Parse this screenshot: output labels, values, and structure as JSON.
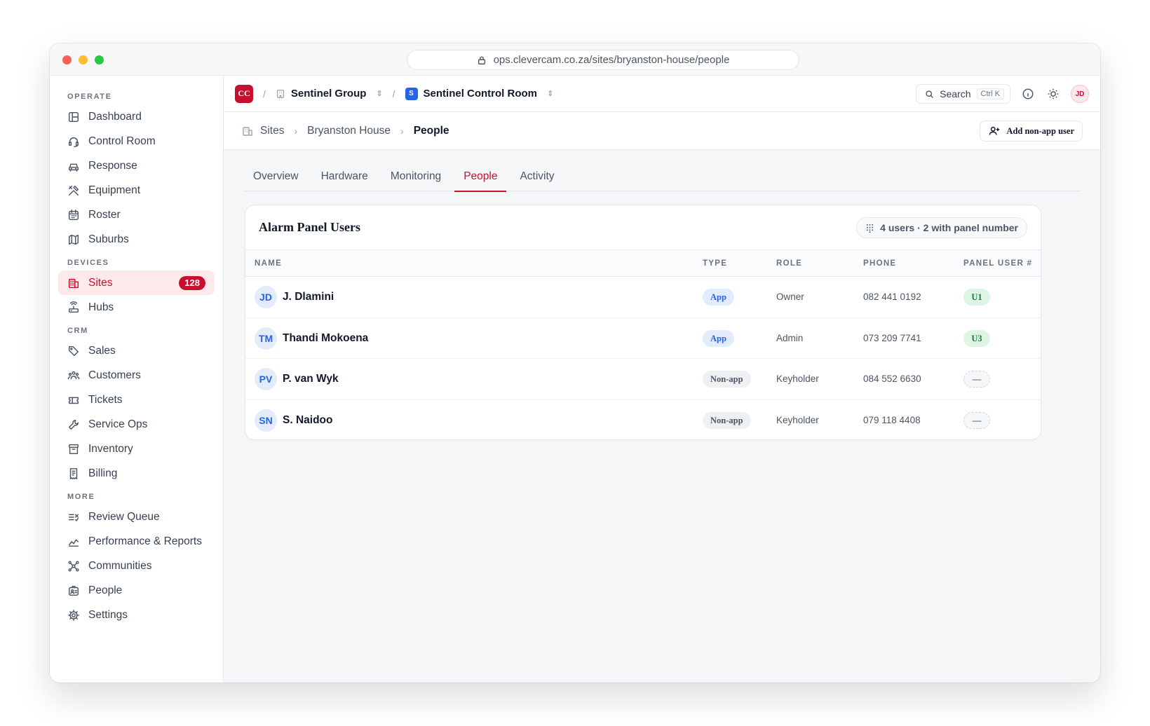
{
  "browser": {
    "url": "ops.clevercam.co.za/sites/bryanston-house/people"
  },
  "sidebar": {
    "sections": [
      {
        "label": "OPERATE",
        "items": [
          {
            "label": "Dashboard",
            "icon": "layout-icon"
          },
          {
            "label": "Control Room",
            "icon": "headset-icon"
          },
          {
            "label": "Response",
            "icon": "car-icon"
          },
          {
            "label": "Equipment",
            "icon": "tools-icon"
          },
          {
            "label": "Roster",
            "icon": "calendar-icon"
          },
          {
            "label": "Suburbs",
            "icon": "map-icon"
          }
        ]
      },
      {
        "label": "DEVICES",
        "items": [
          {
            "label": "Sites",
            "icon": "building-icon",
            "badge": "128",
            "active": true
          },
          {
            "label": "Hubs",
            "icon": "router-icon"
          }
        ]
      },
      {
        "label": "CRM",
        "items": [
          {
            "label": "Sales",
            "icon": "tag-icon"
          },
          {
            "label": "Customers",
            "icon": "users-icon"
          },
          {
            "label": "Tickets",
            "icon": "ticket-icon"
          },
          {
            "label": "Service Ops",
            "icon": "wrench-icon"
          },
          {
            "label": "Inventory",
            "icon": "archive-icon"
          },
          {
            "label": "Billing",
            "icon": "receipt-icon"
          }
        ]
      },
      {
        "label": "MORE",
        "items": [
          {
            "label": "Review Queue",
            "icon": "list-check-icon"
          },
          {
            "label": "Performance & Reports",
            "icon": "trend-icon"
          },
          {
            "label": "Communities",
            "icon": "network-icon"
          },
          {
            "label": "People",
            "icon": "id-badge-icon"
          },
          {
            "label": "Settings",
            "icon": "gear-icon"
          }
        ]
      }
    ]
  },
  "topbar": {
    "logo": "CC",
    "org": "Sentinel Group",
    "workspace_logo": "S",
    "workspace": "Sentinel Control Room",
    "search_label": "Search",
    "search_shortcut": "Ctrl K",
    "avatar": "JD"
  },
  "pagebar": {
    "crumbs": [
      "Sites",
      "Bryanston House"
    ],
    "current": "People",
    "add_button": "Add non-app user"
  },
  "tabs": [
    {
      "label": "Overview"
    },
    {
      "label": "Hardware"
    },
    {
      "label": "Monitoring"
    },
    {
      "label": "People",
      "active": true
    },
    {
      "label": "Activity"
    }
  ],
  "card": {
    "title": "Alarm Panel Users",
    "count": "4 users · 2 with panel number",
    "columns": [
      "NAME",
      "TYPE",
      "ROLE",
      "PHONE",
      "PANEL USER #"
    ],
    "rows": [
      {
        "initials": "JD",
        "name": "J. Dlamini",
        "type": "App",
        "role": "Owner",
        "phone": "082 441 0192",
        "panel": "U1"
      },
      {
        "initials": "TM",
        "name": "Thandi Mokoena",
        "type": "App",
        "role": "Admin",
        "phone": "073 209 7741",
        "panel": "U3"
      },
      {
        "initials": "PV",
        "name": "P. van Wyk",
        "type": "Non-app",
        "role": "Keyholder",
        "phone": "084 552 6630",
        "panel": "—"
      },
      {
        "initials": "SN",
        "name": "S. Naidoo",
        "type": "Non-app",
        "role": "Keyholder",
        "phone": "079 118 4408",
        "panel": "—"
      }
    ]
  },
  "colors": {
    "accent": "#c8102e",
    "app_blue": "#2563eb",
    "panel_green": "#15803d"
  }
}
